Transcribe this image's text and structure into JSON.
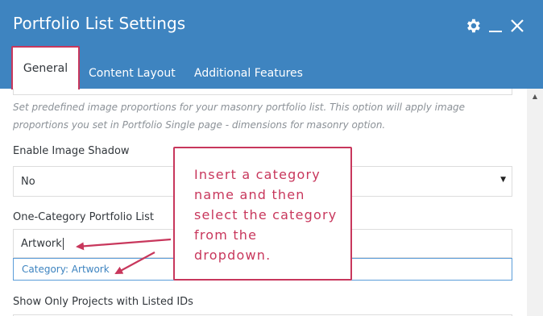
{
  "window": {
    "title": "Portfolio List Settings",
    "icons": [
      "gear-icon",
      "minimize-icon",
      "close-icon"
    ]
  },
  "tabs": [
    {
      "label": "General",
      "active": true
    },
    {
      "label": "Content Layout",
      "active": false
    },
    {
      "label": "Additional Features",
      "active": false
    }
  ],
  "settings": {
    "description": "Set predefined image proportions for your masonry portfolio list. This option will apply image proportions you set in Portfolio Single page - dimensions for masonry option.",
    "image_shadow": {
      "label": "Enable Image Shadow",
      "value": "No"
    },
    "one_category": {
      "label": "One-Category Portfolio List",
      "value": "Artwork",
      "suggestion": "Category: Artwork"
    },
    "listed_ids": {
      "label": "Show Only Projects with Listed IDs"
    }
  },
  "annotation": {
    "text": "Insert a category name and then select the category from the dropdown."
  },
  "colors": {
    "header": "#3e84c0",
    "annotation": "#c8375c",
    "link": "#3e84c0"
  }
}
